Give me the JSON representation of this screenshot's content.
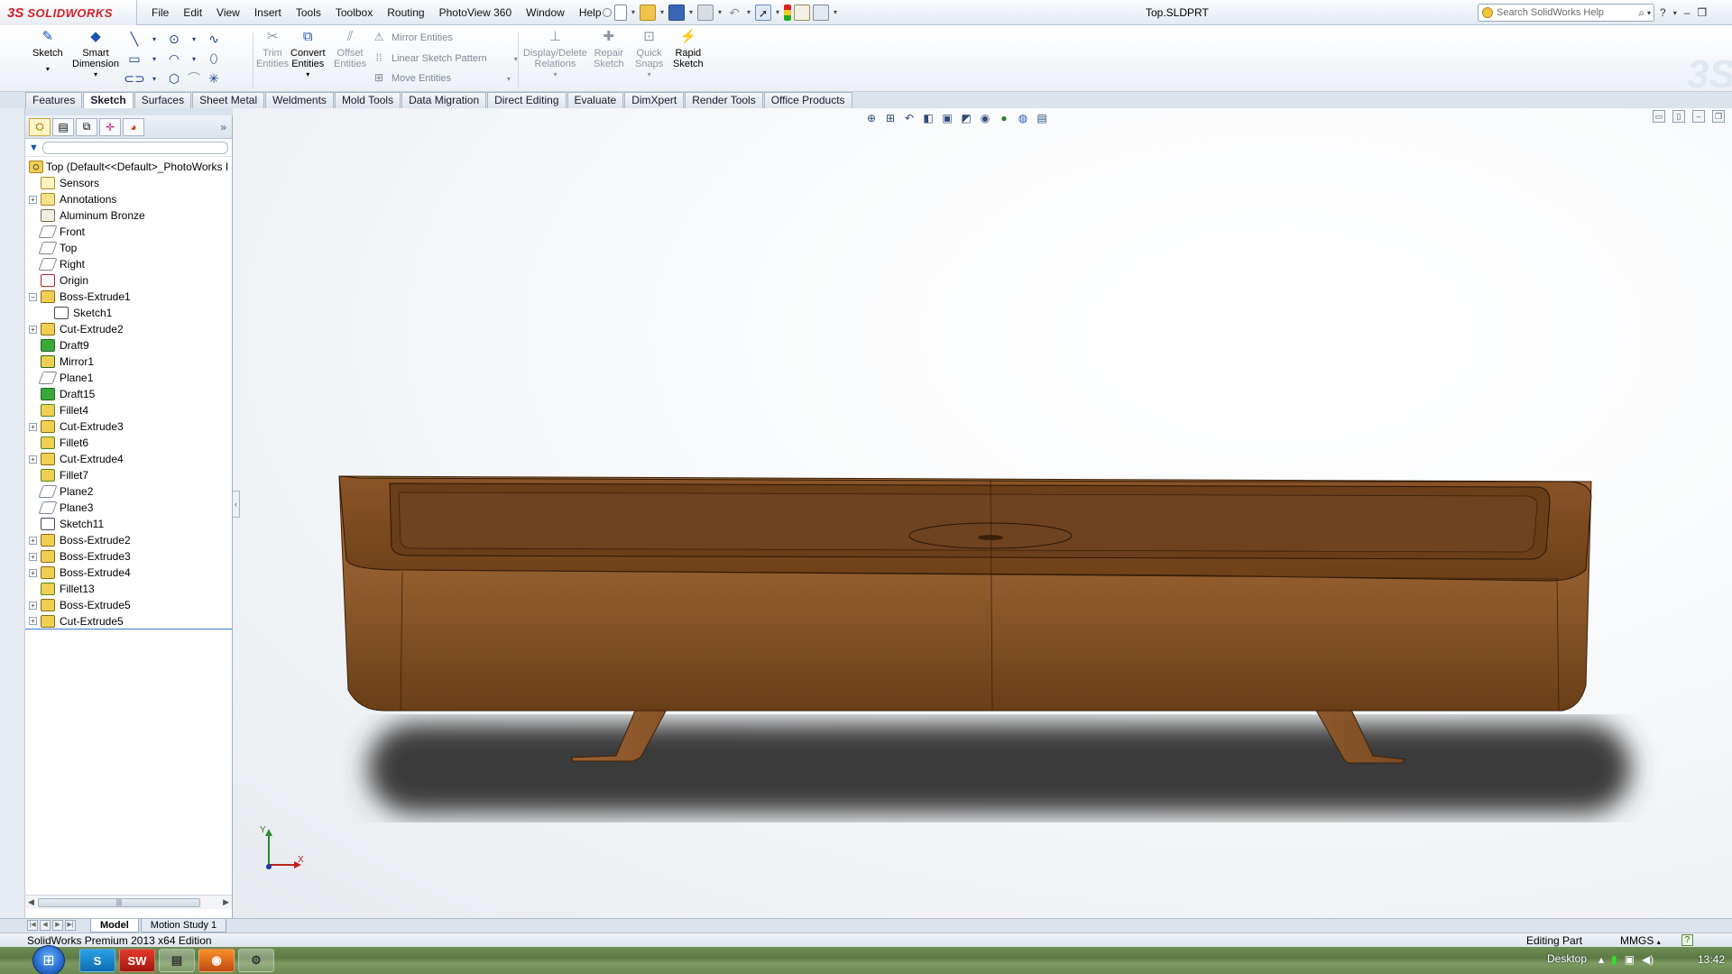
{
  "app": {
    "logo_ds": "3S",
    "logo_text": "SOLIDWORKS",
    "document_title": "Top.SLDPRT"
  },
  "menu": [
    "File",
    "Edit",
    "View",
    "Insert",
    "Tools",
    "Toolbox",
    "Routing",
    "PhotoView 360",
    "Window",
    "Help"
  ],
  "search": {
    "placeholder": "Search SolidWorks Help"
  },
  "command_manager": {
    "sketch": "Sketch",
    "smart_dimension_1": "Smart",
    "smart_dimension_2": "Dimension",
    "trim_1": "Trim",
    "trim_2": "Entities",
    "convert_1": "Convert",
    "convert_2": "Entities",
    "offset_1": "Offset",
    "offset_2": "Entities",
    "mirror": "Mirror Entities",
    "linear_pattern": "Linear Sketch Pattern",
    "move": "Move Entities",
    "display_delete_1": "Display/Delete",
    "display_delete_2": "Relations",
    "repair_1": "Repair",
    "repair_2": "Sketch",
    "quick_snaps_1": "Quick",
    "quick_snaps_2": "Snaps",
    "rapid_1": "Rapid",
    "rapid_2": "Sketch"
  },
  "cm_tabs": [
    "Features",
    "Sketch",
    "Surfaces",
    "Sheet Metal",
    "Weldments",
    "Mold Tools",
    "Data Migration",
    "Direct Editing",
    "Evaluate",
    "DimXpert",
    "Render Tools",
    "Office Products"
  ],
  "cm_active_tab": "Sketch",
  "feature_tree": {
    "root": "Top  (Default<<Default>_PhotoWorks I",
    "items": [
      {
        "label": "Sensors",
        "icon": "sensor-icon",
        "expandable": false
      },
      {
        "label": "Annotations",
        "icon": "annotations-icon",
        "expandable": true
      },
      {
        "label": "Aluminum Bronze",
        "icon": "material-icon",
        "expandable": false
      },
      {
        "label": "Front",
        "icon": "plane-icon",
        "expandable": false
      },
      {
        "label": "Top",
        "icon": "plane-icon",
        "expandable": false
      },
      {
        "label": "Right",
        "icon": "plane-icon",
        "expandable": false
      },
      {
        "label": "Origin",
        "icon": "origin-icon",
        "expandable": false
      },
      {
        "label": "Boss-Extrude1",
        "icon": "extrude-icon",
        "expandable": true,
        "expanded": true
      },
      {
        "label": "Sketch1",
        "icon": "sketch-icon",
        "expandable": false,
        "child": true
      },
      {
        "label": "Cut-Extrude2",
        "icon": "cut-extrude-icon",
        "expandable": true
      },
      {
        "label": "Draft9",
        "icon": "draft-icon",
        "expandable": false
      },
      {
        "label": "Mirror1",
        "icon": "mirror-icon",
        "expandable": false
      },
      {
        "label": "Plane1",
        "icon": "plane-icon",
        "expandable": false
      },
      {
        "label": "Draft15",
        "icon": "draft-icon",
        "expandable": false
      },
      {
        "label": "Fillet4",
        "icon": "fillet-icon",
        "expandable": false
      },
      {
        "label": "Cut-Extrude3",
        "icon": "cut-extrude-icon",
        "expandable": true
      },
      {
        "label": "Fillet6",
        "icon": "fillet-icon",
        "expandable": false
      },
      {
        "label": "Cut-Extrude4",
        "icon": "cut-extrude-icon",
        "expandable": true
      },
      {
        "label": "Fillet7",
        "icon": "fillet-icon",
        "expandable": false
      },
      {
        "label": "Plane2",
        "icon": "plane-icon",
        "expandable": false
      },
      {
        "label": "Plane3",
        "icon": "plane-icon",
        "expandable": false
      },
      {
        "label": "Sketch11",
        "icon": "sketch-icon",
        "expandable": false
      },
      {
        "label": "Boss-Extrude2",
        "icon": "extrude-icon",
        "expandable": true
      },
      {
        "label": "Boss-Extrude3",
        "icon": "extrude-icon",
        "expandable": true
      },
      {
        "label": "Boss-Extrude4",
        "icon": "extrude-icon",
        "expandable": true
      },
      {
        "label": "Fillet13",
        "icon": "fillet-icon",
        "expandable": false
      },
      {
        "label": "Boss-Extrude5",
        "icon": "extrude-icon",
        "expandable": true
      },
      {
        "label": "Cut-Extrude5",
        "icon": "cut-extrude-icon",
        "expandable": true
      }
    ]
  },
  "triad": {
    "y": "Y",
    "x": "X"
  },
  "bottom_tabs": [
    "Model",
    "Motion Study 1"
  ],
  "status": {
    "left": "SolidWorks Premium 2013 x64 Edition",
    "mode": "Editing Part",
    "units": "MMGS"
  },
  "taskbar": {
    "desktop": "Desktop",
    "clock": "13:42"
  },
  "colors": {
    "model_wood": "#7a4a22",
    "model_wood_light": "#a06a38",
    "model_wood_dark": "#4a2a10",
    "shadow": "#3e3e3e",
    "accent_blue": "#3a78d0"
  }
}
